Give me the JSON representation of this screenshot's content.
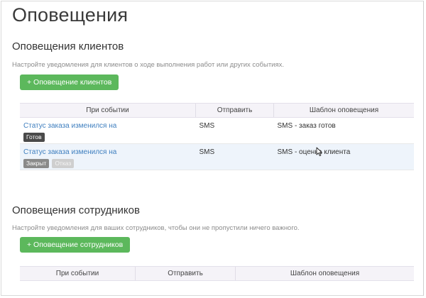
{
  "page": {
    "title": "Оповещения"
  },
  "clients": {
    "title": "Оповещения клиентов",
    "description": "Настройте уведомления для клиентов о ходе выполнения работ или других событиях.",
    "add_button": "+ Оповещение клиентов",
    "columns": [
      "При событии",
      "Отправить",
      "Шаблон оповещения"
    ],
    "rows": [
      {
        "event": "Статус заказа изменился на",
        "tags": [
          "Готов"
        ],
        "send": "SMS",
        "template": "SMS - заказ готов"
      },
      {
        "event": "Статус заказа изменился на",
        "tags": [
          "Закрыт",
          "Отказ"
        ],
        "send": "SMS",
        "template": "SMS - оценка клиента"
      }
    ]
  },
  "staff": {
    "title": "Оповещения сотрудников",
    "description": "Настройте уведомления для ваших сотрудников, чтобы они не пропустили ничего важного.",
    "add_button": "+ Оповещение сотрудников",
    "columns": [
      "При событии",
      "Отправить",
      "Шаблон оповещения"
    ]
  },
  "colors": {
    "accent": "#5cb85c",
    "link": "#3f7fbf",
    "header_bg": "#f5f3f8",
    "row_highlight": "#eef4fb"
  },
  "icons": {
    "cursor": "mouse-pointer-icon"
  }
}
